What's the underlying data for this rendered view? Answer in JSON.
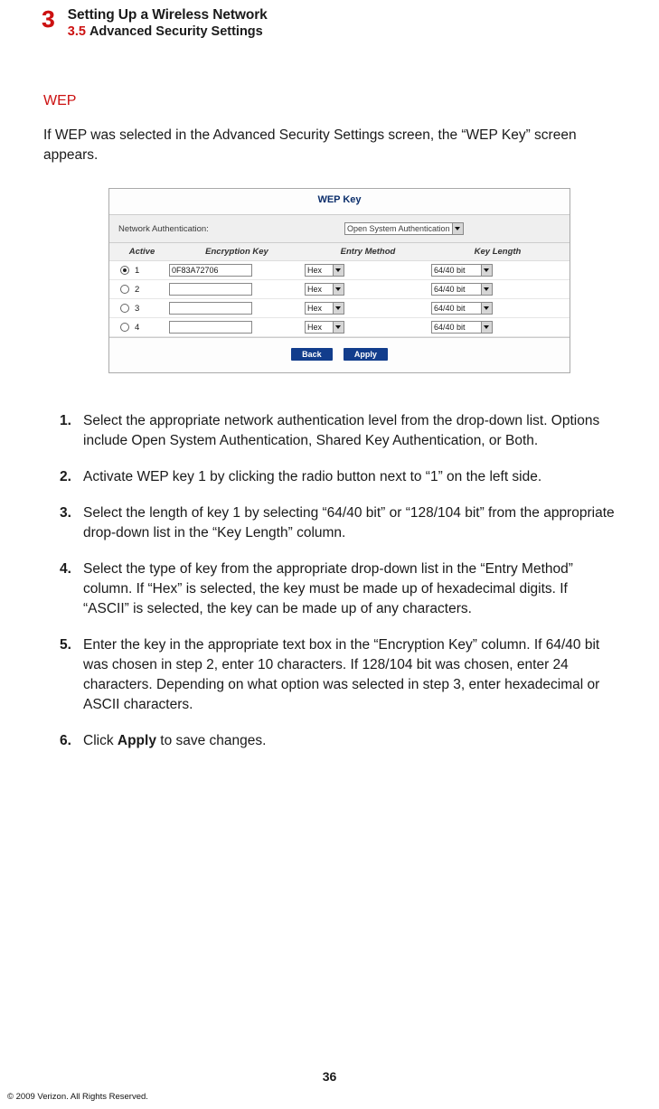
{
  "header": {
    "chapter_number": "3",
    "chapter_title": "Setting Up a Wireless Network",
    "section_number": "3.5",
    "section_title": "Advanced Security Settings"
  },
  "doc": {
    "wep_heading": "WEP",
    "intro": "If WEP was selected in the Advanced Security Settings screen, the “WEP Key” screen appears.",
    "page_number": "36",
    "copyright": "© 2009 Verizon. All Rights Reserved."
  },
  "panel": {
    "title": "WEP Key",
    "auth_label": "Network Authentication:",
    "auth_value": "Open System Authentication",
    "columns": {
      "active": "Active",
      "key": "Encryption Key",
      "method": "Entry Method",
      "length": "Key Length"
    },
    "rows": [
      {
        "n": "1",
        "checked": true,
        "key": "0F83A72706",
        "method": "Hex",
        "length": "64/40 bit"
      },
      {
        "n": "2",
        "checked": false,
        "key": "",
        "method": "Hex",
        "length": "64/40 bit"
      },
      {
        "n": "3",
        "checked": false,
        "key": "",
        "method": "Hex",
        "length": "64/40 bit"
      },
      {
        "n": "4",
        "checked": false,
        "key": "",
        "method": "Hex",
        "length": "64/40 bit"
      }
    ],
    "buttons": {
      "back": "Back",
      "apply": "Apply"
    }
  },
  "steps": [
    "Select the appropriate network authentication level from the drop-down list. Options include Open System Authentication, Shared Key Authentication, or Both.",
    "Activate WEP key 1 by clicking the radio button next to “1” on the left side.",
    "Select the length of key 1 by selecting “64/40 bit” or “128/104 bit” from the appropriate drop-down list in the “Key Length” column.",
    "Select the type of key from the appropriate drop-down list in the “Entry Method” column. If “Hex” is selected, the key must be made up of hexadecimal digits. If “ASCII” is selected, the key can be made up of any characters.",
    "Enter the key in the appropriate text box in the “Encryption Key” column. If 64/40 bit was chosen in step 2, enter 10 characters. If 128/104 bit was chosen, enter 24 characters. Depending on what option was selected in step 3, enter hexadecimal or ASCII characters."
  ],
  "step6_prefix": "Click ",
  "step6_bold": "Apply",
  "step6_suffix": " to save changes."
}
